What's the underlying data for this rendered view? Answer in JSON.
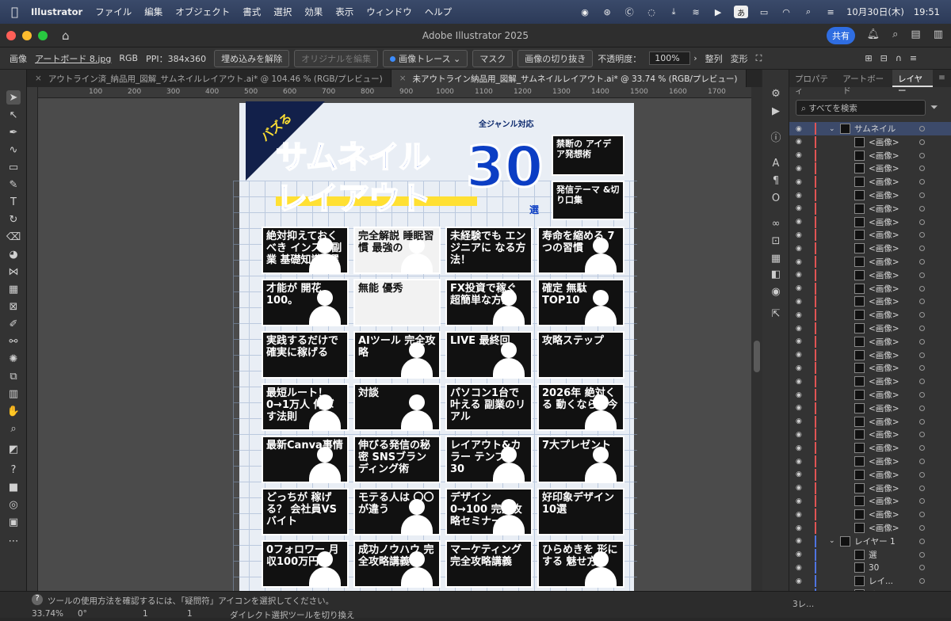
{
  "menubar": {
    "app": "Illustrator",
    "items": [
      "ファイル",
      "編集",
      "オブジェクト",
      "書式",
      "選択",
      "効果",
      "表示",
      "ウィンドウ",
      "ヘルプ"
    ],
    "ime": "あ",
    "date": "10月30日(木)",
    "time": "19:51"
  },
  "window": {
    "title": "Adobe Illustrator 2025",
    "share": "共有"
  },
  "control": {
    "type": "画像",
    "file": "アートボード 8.jpg",
    "color": "RGB",
    "ppi": "PPI：384x360",
    "embed_undo": "埋め込みを解除",
    "edit_original": "オリジナルを編集",
    "trace": "画像トレース",
    "mask": "マスク",
    "crop": "画像の切り抜き",
    "opacity_label": "不透明度：",
    "opacity": "100%",
    "align": "整列",
    "transform": "変形"
  },
  "tabs": [
    {
      "label": "アウトライン済_納品用_図解_サムネイルレイアウト.ai* @ 104.46 % (RGB/プレビュー)"
    },
    {
      "label": "未アウトライン納品用_図解_サムネイルレイアウト.ai* @ 33.74 % (RGB/プレビュー)"
    }
  ],
  "ruler": [
    "100",
    "200",
    "300",
    "400",
    "500",
    "600",
    "700",
    "800",
    "900",
    "1000",
    "1100",
    "1200",
    "1300",
    "1400",
    "1500",
    "1600",
    "1700"
  ],
  "artwork": {
    "banner": "バズる",
    "genre": "全ジャンル対応",
    "title1": "サムネイル",
    "title2": "レイアウト",
    "number": "30",
    "unit": "選",
    "thumbs": [
      "絶対抑えておくべき インスタ副業 基礎知識5選",
      "完全解説 睡眠習慣 最強の",
      "未経験でも エンジニアに なる方法！",
      "寿命を縮める 7つの習慣",
      "才能が 開花 100。",
      "無能 優秀",
      "FX投資で稼ぐ 超簡単な方法",
      "確定 無駄 TOP10",
      "実践するだけで 確実に稼げる",
      "AIツール 完全攻略",
      "LIVE 最終回",
      "攻略ステップ",
      "最短ルート！ 0→1万人 伸ばす法則",
      "対談",
      "パソコン1台で叶える 副業のリアル",
      "2026年 絶対くる 動くなら、今",
      "最新Canva事情",
      "伸びる発信の秘密 SNSブランディング術",
      "レイアウト&カラー テンプレ30",
      "7大プレゼント",
      "どっちが 稼げる？ 会社員VSバイト",
      "モテる人は 〇〇が違う",
      "デザイン 0→100 完全攻略セミナー",
      "好印象デザイン 10選",
      "0フォロワー 月収100万円",
      "成功ノウハウ 完全攻略講義",
      "マーケティング 完全攻略講義",
      "ひらめきを 形にする 魅せ方術"
    ],
    "side1": "禁断の アイデア発想術",
    "side2": "発信テーマ &切り口集"
  },
  "panel": {
    "tabs": [
      "プロパティ",
      "アートボード",
      "レイヤー"
    ],
    "search": "すべてを検索",
    "layers": [
      {
        "name": "サムネイル",
        "top": true
      },
      {
        "name": "<画像>"
      },
      {
        "name": "<画像>"
      },
      {
        "name": "<画像>"
      },
      {
        "name": "<画像>"
      },
      {
        "name": "<画像>"
      },
      {
        "name": "<画像>"
      },
      {
        "name": "<画像>"
      },
      {
        "name": "<画像>"
      },
      {
        "name": "<画像>"
      },
      {
        "name": "<画像>"
      },
      {
        "name": "<画像>"
      },
      {
        "name": "<画像>"
      },
      {
        "name": "<画像>"
      },
      {
        "name": "<画像>"
      },
      {
        "name": "<画像>"
      },
      {
        "name": "<画像>"
      },
      {
        "name": "<画像>"
      },
      {
        "name": "<画像>"
      },
      {
        "name": "<画像>"
      },
      {
        "name": "<画像>"
      },
      {
        "name": "<画像>"
      },
      {
        "name": "<画像>"
      },
      {
        "name": "<画像>"
      },
      {
        "name": "<画像>"
      },
      {
        "name": "<画像>"
      },
      {
        "name": "<画像>"
      },
      {
        "name": "<画像>"
      },
      {
        "name": "<画像>"
      },
      {
        "name": "<画像>"
      },
      {
        "name": "<画像>"
      },
      {
        "name": "レイヤー 1",
        "top": true
      },
      {
        "name": "選"
      },
      {
        "name": "30"
      },
      {
        "name": "レイ..."
      },
      {
        "name": "サム..."
      }
    ],
    "count": "3レ..."
  },
  "status": {
    "hint": "ツールの使用方法を確認するには、「疑問符」アイコンを選択してください。",
    "zoom": "33.74%",
    "rotation": "0°",
    "page": "1",
    "page2": "1",
    "tool": "ダイレクト選択ツールを切り換え"
  },
  "colors": {
    "accent": "#2f6de1",
    "brand_blue": "#0c3ec4",
    "yellow": "#ffe033"
  }
}
